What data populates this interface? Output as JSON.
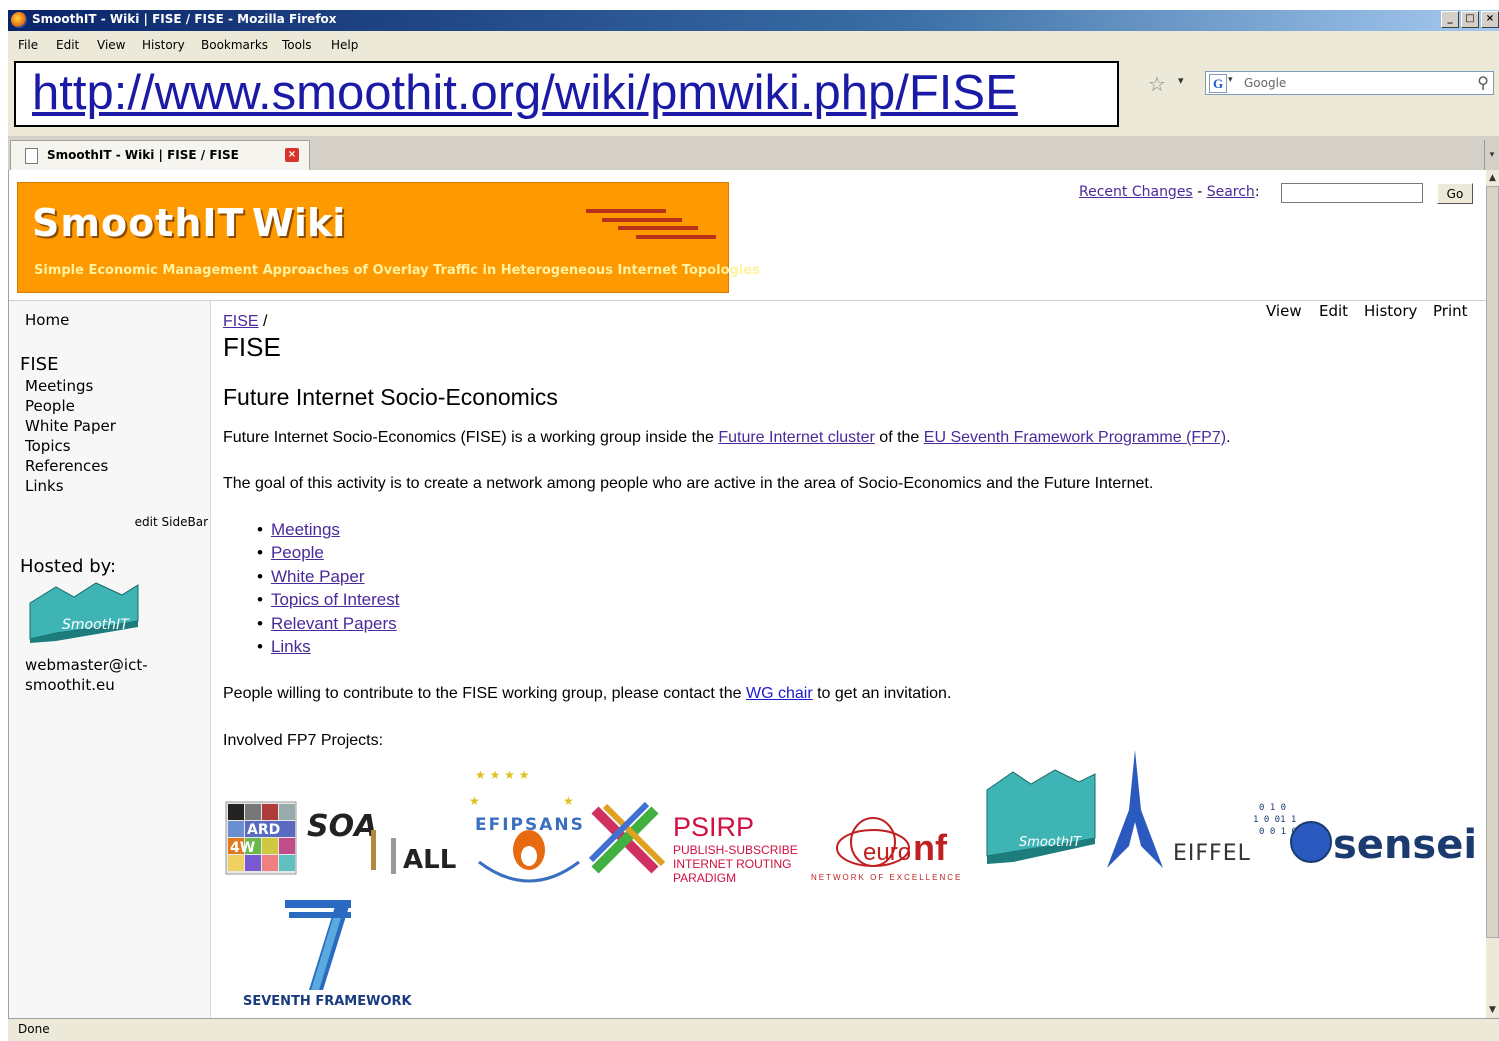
{
  "window": {
    "title": "SmoothIT - Wiki | FISE / FISE - Mozilla Firefox",
    "min": "_",
    "max": "□",
    "close": "×"
  },
  "menu": [
    "File",
    "Edit",
    "View",
    "History",
    "Bookmarks",
    "Tools",
    "Help"
  ],
  "address": {
    "url": "http://www.smoothit.org/wiki/pmwiki.php/FISE"
  },
  "search": {
    "engine_icon": "G",
    "placeholder": "Google"
  },
  "tab": {
    "label": "SmoothIT - Wiki | FISE / FISE"
  },
  "banner": {
    "word1": "SmoothIT",
    "word2": "Wiki",
    "subtitle": "Simple Economic Management Approaches of Overlay Traffic in Heterogeneous Internet Topologies"
  },
  "header_links": {
    "recent": "Recent Changes",
    "sep": "-",
    "search": "Search",
    "colon": ":",
    "go": "Go"
  },
  "page_actions": [
    "View",
    "Edit",
    "History",
    "Print"
  ],
  "sidebar": {
    "home": "Home",
    "group_title": "FISE",
    "items": [
      "Meetings",
      "People",
      "White Paper",
      "Topics",
      "References",
      "Links"
    ],
    "edit": "edit SideBar",
    "hosted_by": "Hosted by:",
    "logo_text": "SmoothIT",
    "email_line1": "webmaster@ict-",
    "email_line2": "smoothit.eu"
  },
  "main": {
    "breadcrumb": "FISE",
    "breadcrumb_sep": "/",
    "page_title": "FISE",
    "heading": "Future Internet Socio-Economics",
    "para1_pre": "Future Internet Socio-Economics (FISE) is a working group inside the ",
    "para1_link1": "Future Internet cluster",
    "para1_mid": " of the ",
    "para1_link2": "EU Seventh Framework Programme (FP7)",
    "para1_post": ".",
    "para2": "The goal of this activity is to create a network among people who are active in the area of Socio-Economics and the Future Internet.",
    "links": [
      "Meetings",
      "People",
      "White Paper",
      "Topics of Interest",
      "Relevant Papers",
      "Links"
    ],
    "para3_pre": "People willing to contribute to the FISE working group, please contact the ",
    "para3_link": "WG chair",
    "para3_post": " to get an invitation.",
    "involved": "Involved FP7 Projects:"
  },
  "logos": {
    "ard": "ARD",
    "ard2": "4W",
    "soa": "SOA",
    "all": "ALL",
    "efipsans": "EFIPSANS",
    "psirp": "PSIRP",
    "psirp_sub1": "PUBLISH-SUBSCRIBE",
    "psirp_sub2": "INTERNET ROUTING",
    "psirp_sub3": "PARADIGM",
    "euronf_euro": "euro",
    "euronf_nf": "nf",
    "euronf_sub": "NETWORK OF EXCELLENCE",
    "smoothit": "SmoothIT",
    "eiffel": "EIFFEL",
    "sensei": "sensei",
    "fp7": "SEVENTH FRAMEWORK"
  },
  "status": {
    "text": "Done"
  },
  "colors": {
    "banner": "#ff9900",
    "link": "#4a2a9a",
    "titlebar": "#0a246a"
  }
}
